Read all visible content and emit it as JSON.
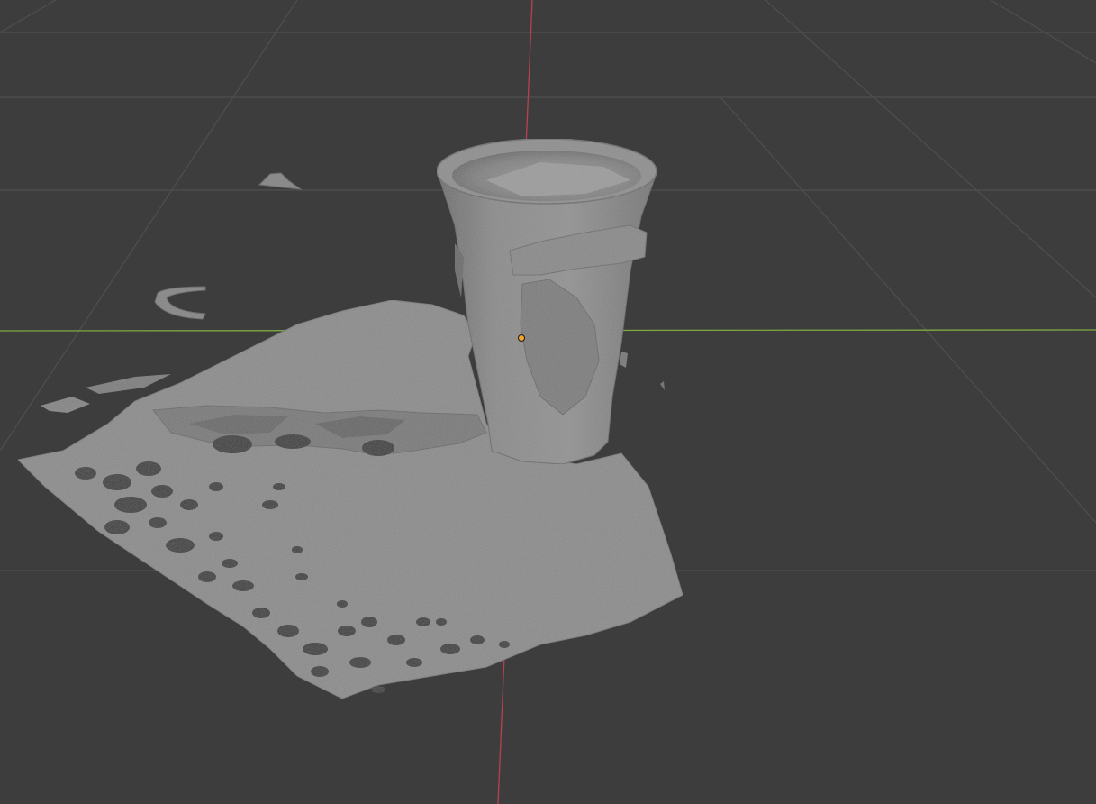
{
  "app": {
    "name": "3D viewport",
    "view": "perspective",
    "shading": "solid"
  },
  "colors": {
    "background": "#3d3d3d",
    "grid_line": "#4e4e4e",
    "x_axis": "#b8404f",
    "y_axis": "#7fa842",
    "mesh_light": "#8e8e8e",
    "mesh_mid": "#7c7c7c",
    "mesh_dark": "#5f5f5f",
    "origin_point": "#f4a52a"
  },
  "scene": {
    "objects": [
      {
        "name": "scanned-cup",
        "type": "mesh"
      },
      {
        "name": "scanned-ground-patch",
        "type": "mesh"
      },
      {
        "name": "floating-fragment-small",
        "type": "mesh"
      },
      {
        "name": "floating-fragment-curved",
        "type": "mesh"
      }
    ],
    "selected_origin": "object-origin"
  }
}
